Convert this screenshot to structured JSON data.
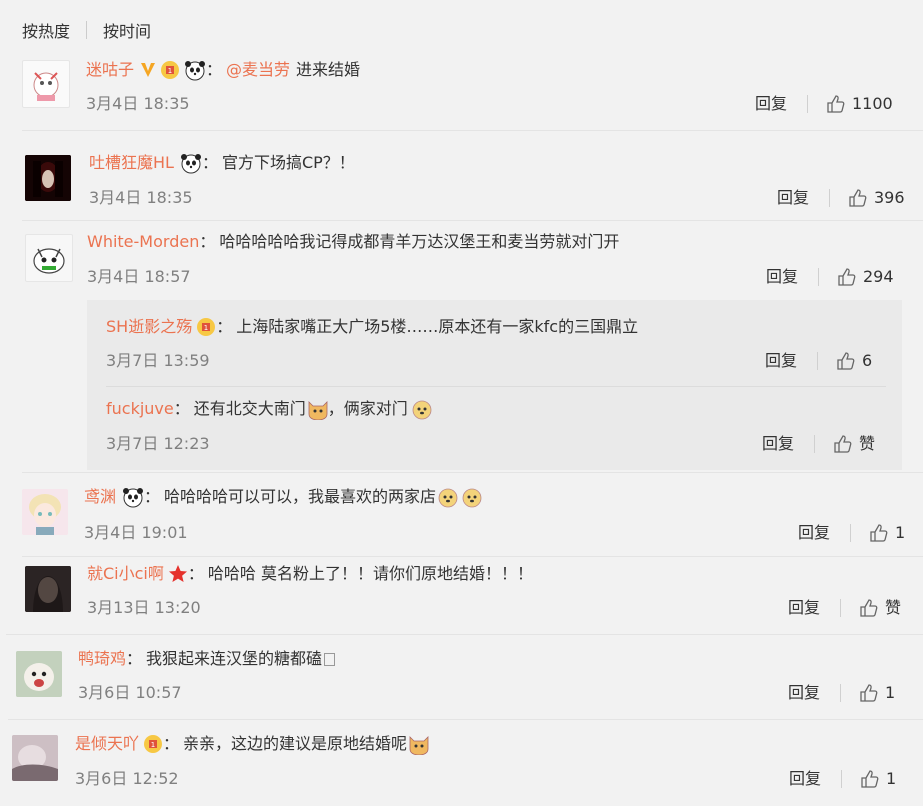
{
  "tabs": [
    "按热度",
    "按时间"
  ],
  "reply_label": "回复",
  "colors": {
    "name": "#eb7350",
    "meta": "#808080",
    "bg": "#f2f2f2",
    "subbox": "#eaeaea"
  },
  "comments": [
    {
      "name": "迷咕子",
      "mention": "@麦当劳",
      "text": "进来结婚",
      "time": "3月4日 18:35",
      "likes": "1100"
    },
    {
      "name": "吐槽狂魔HL",
      "text": "官方下场搞CP？！",
      "time": "3月4日 18:35",
      "likes": "396"
    },
    {
      "name": "White-Morden",
      "text": "哈哈哈哈哈我记得成都青羊万达汉堡王和麦当劳就对门开",
      "time": "3月4日 18:57",
      "likes": "294"
    },
    {
      "name": "SH逝影之殇",
      "text": "上海陆家嘴正大广场5楼……原本还有一家kfc的三国鼎立",
      "time": "3月7日 13:59",
      "likes": "6"
    },
    {
      "name": "fuckjuve",
      "text": "还有北交大南门",
      "text2": "，俩家对门",
      "time": "3月7日 12:23",
      "likes": "赞"
    },
    {
      "name": "鸢渊",
      "text": "哈哈哈哈可以可以，我最喜欢的两家店",
      "time": "3月4日 19:01",
      "likes": "1"
    },
    {
      "name": "就Ci小ci啊",
      "text": "哈哈哈 莫名粉上了！！请你们原地结婚！！！",
      "time": "3月13日 13:20",
      "likes": "赞"
    },
    {
      "name": "鸭琦鸡",
      "text": "我狠起来连汉堡的糖都磕",
      "time": "3月6日 10:57",
      "likes": "1"
    },
    {
      "name": "是倾天吖",
      "text": "亲亲，这边的建议是原地结婚呢",
      "time": "3月6日 12:52",
      "likes": "1"
    }
  ]
}
